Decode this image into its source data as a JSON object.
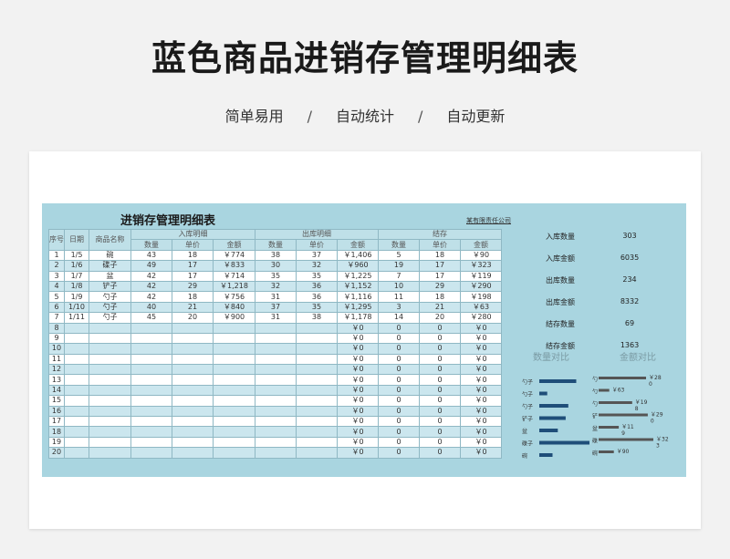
{
  "hero": {
    "title": "蓝色商品进销存管理明细表"
  },
  "subtitle": [
    "简单易用",
    "自动统计",
    "自动更新"
  ],
  "subtitle_sep": "/",
  "sheet": {
    "title": "进销存管理明细表",
    "company": "某有限责任公司",
    "groups": {
      "in": "入库明细",
      "out": "出库明细",
      "stock": "结存"
    },
    "headers": {
      "seq": "序号",
      "date": "日期",
      "name": "商品名称",
      "qty": "数量",
      "price": "单价",
      "amount": "金额"
    },
    "rows": [
      {
        "seq": "1",
        "date": "1/5",
        "name": "碗",
        "in": [
          "43",
          "18",
          "￥774"
        ],
        "out": [
          "38",
          "37",
          "￥1,406"
        ],
        "stock": [
          "5",
          "18",
          "￥90"
        ]
      },
      {
        "seq": "2",
        "date": "1/6",
        "name": "碟子",
        "in": [
          "49",
          "17",
          "￥833"
        ],
        "out": [
          "30",
          "32",
          "￥960"
        ],
        "stock": [
          "19",
          "17",
          "￥323"
        ]
      },
      {
        "seq": "3",
        "date": "1/7",
        "name": "盆",
        "in": [
          "42",
          "17",
          "￥714"
        ],
        "out": [
          "35",
          "35",
          "￥1,225"
        ],
        "stock": [
          "7",
          "17",
          "￥119"
        ]
      },
      {
        "seq": "4",
        "date": "1/8",
        "name": "铲子",
        "in": [
          "42",
          "29",
          "￥1,218"
        ],
        "out": [
          "32",
          "36",
          "￥1,152"
        ],
        "stock": [
          "10",
          "29",
          "￥290"
        ]
      },
      {
        "seq": "5",
        "date": "1/9",
        "name": "勺子",
        "in": [
          "42",
          "18",
          "￥756"
        ],
        "out": [
          "31",
          "36",
          "￥1,116"
        ],
        "stock": [
          "11",
          "18",
          "￥198"
        ]
      },
      {
        "seq": "6",
        "date": "1/10",
        "name": "勺子",
        "in": [
          "40",
          "21",
          "￥840"
        ],
        "out": [
          "37",
          "35",
          "￥1,295"
        ],
        "stock": [
          "3",
          "21",
          "￥63"
        ]
      },
      {
        "seq": "7",
        "date": "1/11",
        "name": "勺子",
        "in": [
          "45",
          "20",
          "￥900"
        ],
        "out": [
          "31",
          "38",
          "￥1,178"
        ],
        "stock": [
          "14",
          "20",
          "￥280"
        ]
      },
      {
        "seq": "8",
        "out_amt": "￥0",
        "stock": [
          "0",
          "0",
          "￥0"
        ]
      },
      {
        "seq": "9",
        "out_amt": "￥0",
        "stock": [
          "0",
          "0",
          "￥0"
        ]
      },
      {
        "seq": "10",
        "out_amt": "￥0",
        "stock": [
          "0",
          "0",
          "￥0"
        ]
      },
      {
        "seq": "11",
        "out_amt": "￥0",
        "stock": [
          "0",
          "0",
          "￥0"
        ]
      },
      {
        "seq": "12",
        "out_amt": "￥0",
        "stock": [
          "0",
          "0",
          "￥0"
        ]
      },
      {
        "seq": "13",
        "out_amt": "￥0",
        "stock": [
          "0",
          "0",
          "￥0"
        ]
      },
      {
        "seq": "14",
        "out_amt": "￥0",
        "stock": [
          "0",
          "0",
          "￥0"
        ]
      },
      {
        "seq": "15",
        "out_amt": "￥0",
        "stock": [
          "0",
          "0",
          "￥0"
        ]
      },
      {
        "seq": "16",
        "out_amt": "￥0",
        "stock": [
          "0",
          "0",
          "￥0"
        ]
      },
      {
        "seq": "17",
        "out_amt": "￥0",
        "stock": [
          "0",
          "0",
          "￥0"
        ]
      },
      {
        "seq": "18",
        "out_amt": "￥0",
        "stock": [
          "0",
          "0",
          "￥0"
        ]
      },
      {
        "seq": "19",
        "out_amt": "￥0",
        "stock": [
          "0",
          "0",
          "￥0"
        ]
      },
      {
        "seq": "20",
        "out_amt": "￥0",
        "stock": [
          "0",
          "0",
          "￥0"
        ]
      }
    ]
  },
  "summary": [
    {
      "label": "入库数量",
      "value": "303"
    },
    {
      "label": "入库金额",
      "value": "6035"
    },
    {
      "label": "出库数量",
      "value": "234"
    },
    {
      "label": "出库金额",
      "value": "8332"
    },
    {
      "label": "结存数量",
      "value": "69"
    },
    {
      "label": "结存金额",
      "value": "1363"
    }
  ],
  "colors": {
    "qty_bar": "#1f4e79",
    "amt_bar": "#555555",
    "sheet_bg": "#a9d5e0"
  },
  "chart_data": [
    {
      "type": "bar",
      "orientation": "horizontal",
      "title": "数量对比",
      "categories": [
        "勺子",
        "勺子",
        "勺子",
        "铲子",
        "盆",
        "碟子",
        "碗"
      ],
      "values": [
        14,
        3,
        11,
        10,
        7,
        19,
        5
      ]
    },
    {
      "type": "bar",
      "orientation": "horizontal",
      "title": "金额对比",
      "categories": [
        "勺",
        "勺",
        "勺",
        "铲",
        "盆",
        "碟",
        "碗"
      ],
      "values": [
        280,
        63,
        198,
        290,
        119,
        323,
        90
      ],
      "data_labels": [
        "￥28\n0",
        "￥63",
        "￥19\n8",
        "￥29\n0",
        "￥11\n9",
        "￥32\n3",
        "￥90"
      ]
    }
  ]
}
